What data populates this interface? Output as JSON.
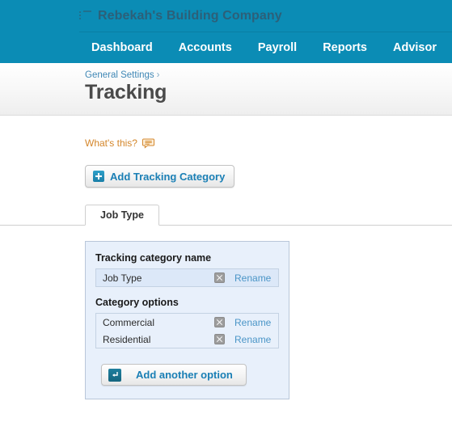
{
  "header": {
    "menu_icon": "list-menu-icon",
    "company_name": "Rebekah's Building Company",
    "nav": [
      {
        "label": "Dashboard"
      },
      {
        "label": "Accounts"
      },
      {
        "label": "Payroll"
      },
      {
        "label": "Reports"
      },
      {
        "label": "Advisor"
      }
    ],
    "accent_color": "#0b8cb5"
  },
  "titleband": {
    "breadcrumb_label": "General Settings",
    "breadcrumb_separator": "›",
    "page_title": "Tracking"
  },
  "help": {
    "label": "What's this?",
    "icon": "speech-bubble-icon",
    "color": "#d4862a"
  },
  "toolbar": {
    "add_category_label": "Add Tracking Category",
    "add_category_icon": "plus-square-icon"
  },
  "tabs": [
    {
      "label": "Job Type",
      "active": true
    }
  ],
  "panel": {
    "category_name_heading": "Tracking category name",
    "category_name_row": {
      "name": "Job Type",
      "delete_icon": "close-x-icon",
      "rename_label": "Rename"
    },
    "options_heading": "Category options",
    "options": [
      {
        "name": "Commercial",
        "delete_icon": "close-x-icon",
        "rename_label": "Rename"
      },
      {
        "name": "Residential",
        "delete_icon": "close-x-icon",
        "rename_label": "Rename"
      }
    ],
    "add_option_label": "Add another option",
    "add_option_icon": "enter-arrow-icon",
    "link_color": "#4a95c7",
    "background_color": "#e8f0fb"
  }
}
